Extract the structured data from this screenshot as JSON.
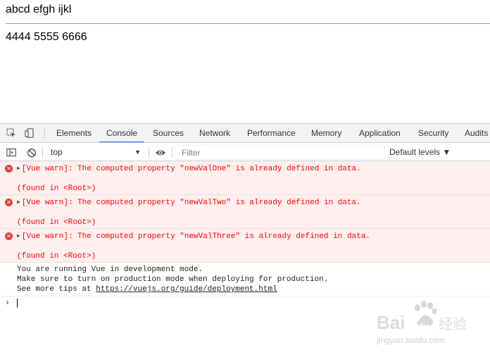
{
  "page": {
    "line1": "abcd efgh ijkl",
    "line2": "4444 5555 6666"
  },
  "devtools": {
    "tabs": [
      "Elements",
      "Console",
      "Sources",
      "Network",
      "Performance",
      "Memory",
      "Application",
      "Security",
      "Audits"
    ],
    "active_tab": "Console",
    "context": "top",
    "filter_placeholder": "Filter",
    "levels": "Default levels ▼",
    "errors": [
      {
        "text": "[Vue warn]: The computed property \"newValOne\" is already defined in data.",
        "found": "(found in <Root>)"
      },
      {
        "text": "[Vue warn]: The computed property \"newValTwo\" is already defined in data.",
        "found": "(found in <Root>)"
      },
      {
        "text": "[Vue warn]: The computed property \"newValThree\" is already defined in data.",
        "found": "(found in <Root>)"
      }
    ],
    "log": {
      "line1": "You are running Vue in development mode.",
      "line2": "Make sure to turn on production mode when deploying for production.",
      "line3_prefix": "See more tips at ",
      "line3_link": "https://vuejs.org/guide/deployment.html"
    },
    "prompt": "›"
  },
  "watermark": {
    "brand": "Bai",
    "brand2": "du",
    "brand_cn": "经验",
    "url": "jingyan.baidu.com"
  },
  "colors": {
    "accent": "#1a73e8",
    "error_bg": "#fff0f0",
    "error_text": "#ff0000"
  }
}
